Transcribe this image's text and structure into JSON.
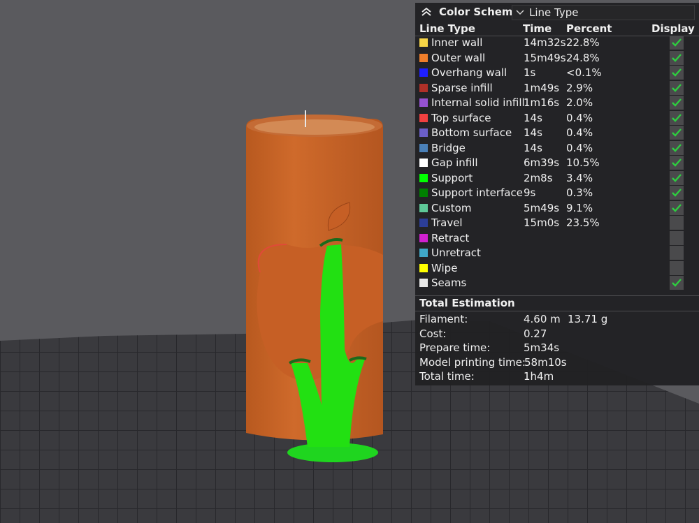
{
  "legend": {
    "title": "Color Scheme",
    "scheme_selected": "Line Type",
    "columns": {
      "line_type": "Line Type",
      "time": "Time",
      "percent": "Percent",
      "display": "Display"
    },
    "rows": [
      {
        "name": "Inner wall",
        "time": "14m32s",
        "percent": "22.8%",
        "color": "#f7d547",
        "display": true
      },
      {
        "name": "Outer wall",
        "time": "15m49s",
        "percent": "24.8%",
        "color": "#f07e2b",
        "display": true
      },
      {
        "name": "Overhang wall",
        "time": "1s",
        "percent": "<0.1%",
        "color": "#1f1fff",
        "display": true
      },
      {
        "name": "Sparse infill",
        "time": "1m49s",
        "percent": "2.9%",
        "color": "#b03028",
        "display": true
      },
      {
        "name": "Internal solid infill",
        "time": "1m16s",
        "percent": "2.0%",
        "color": "#9652d2",
        "display": true
      },
      {
        "name": "Top surface",
        "time": "14s",
        "percent": "0.4%",
        "color": "#f04040",
        "display": true
      },
      {
        "name": "Bottom surface",
        "time": "14s",
        "percent": "0.4%",
        "color": "#6a5ec8",
        "display": true
      },
      {
        "name": "Bridge",
        "time": "14s",
        "percent": "0.4%",
        "color": "#4a80b8",
        "display": true
      },
      {
        "name": "Gap infill",
        "time": "6m39s",
        "percent": "10.5%",
        "color": "#ffffff",
        "display": true
      },
      {
        "name": "Support",
        "time": "2m8s",
        "percent": "3.4%",
        "color": "#00ff00",
        "display": true
      },
      {
        "name": "Support interface",
        "time": "9s",
        "percent": "0.3%",
        "color": "#008000",
        "display": true
      },
      {
        "name": "Custom",
        "time": "5m49s",
        "percent": "9.1%",
        "color": "#5ec898",
        "display": true
      },
      {
        "name": "Travel",
        "time": "15m0s",
        "percent": "23.5%",
        "color": "#2c3e98",
        "display": false
      },
      {
        "name": "Retract",
        "time": "",
        "percent": "",
        "color": "#d020d0",
        "display": false
      },
      {
        "name": "Unretract",
        "time": "",
        "percent": "",
        "color": "#40a8c8",
        "display": false
      },
      {
        "name": "Wipe",
        "time": "",
        "percent": "",
        "color": "#ffff00",
        "display": false
      },
      {
        "name": "Seams",
        "time": "",
        "percent": "",
        "color": "#e8e8e8",
        "display": true
      }
    ],
    "estimation": {
      "title": "Total Estimation",
      "filament_label": "Filament:",
      "filament_length": "4.60 m",
      "filament_weight": "13.71 g",
      "cost_label": "Cost:",
      "cost": "0.27",
      "prepare_label": "Prepare time:",
      "prepare": "5m34s",
      "model_label": "Model printing time:",
      "model": "58m10s",
      "total_label": "Total time:",
      "total": "1h4m"
    }
  },
  "scene": {
    "background": "#5a5a5e",
    "plate": "#3a3a3e",
    "model_color": "#c8662a",
    "support_color": "#22dd11"
  }
}
